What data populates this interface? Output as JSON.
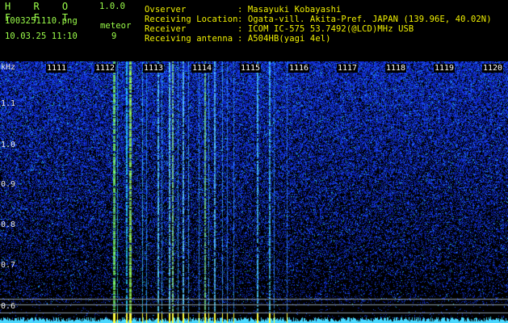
{
  "header": {
    "app_name": "H R O F F T",
    "version": "1.0.0",
    "filename": "1003251110.png",
    "timestamp": "10.03.25 11:10",
    "meteor_label": "meteor",
    "meteor_count": "9",
    "info": [
      {
        "label": "Ovserver",
        "value": ": Masayuki Kobayashi"
      },
      {
        "label": "Receiving Location",
        "value": ": Ogata-vill. Akita-Pref. JAPAN (139.96E, 40.02N)"
      },
      {
        "label": "Receiver",
        "value": ": ICOM IC-575 53.7492(@LCD)MHz USB"
      },
      {
        "label": "Receiving antenna",
        "value": ": A504HB(yagi 4el)"
      }
    ]
  },
  "spectrogram": {
    "y_unit": "kHz",
    "y_ticks": [
      "1.1",
      "1.0",
      "0.9",
      "0.8",
      "0.7",
      "0.6"
    ],
    "x_ticks": [
      "1111",
      "1112",
      "1113",
      "1114",
      "1115",
      "1116",
      "1117",
      "1118",
      "1119",
      "1120"
    ],
    "colors": {
      "background": "#000000",
      "noise": "#1a3cff",
      "echo": "#66ff66",
      "text_green": "#9cff4a",
      "text_yellow": "#f0f000"
    }
  }
}
